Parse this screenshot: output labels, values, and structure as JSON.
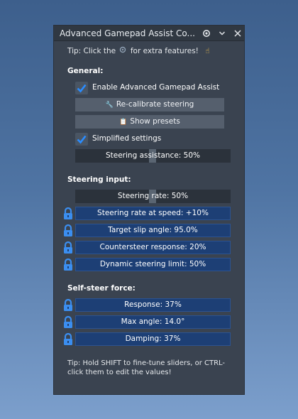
{
  "window": {
    "title": "Advanced Gamepad Assist Co...",
    "icons": [
      "gear-icon",
      "chevron-down-icon",
      "close-icon"
    ]
  },
  "tip_top": {
    "before": "Tip: Click the",
    "after": "for extra features!",
    "icons": [
      "gear-icon",
      "pointing-hand-icon"
    ]
  },
  "general": {
    "heading": "General:",
    "enable_label": "Enable Advanced Gamepad Assist",
    "enable_checked": true,
    "recalibrate_label": "Re-calibrate steering",
    "presets_label": "Show presets",
    "simplified_label": "Simplified settings",
    "simplified_checked": true,
    "steering_assistance": "Steering assistance: 50%",
    "steering_assistance_value": 0.5
  },
  "steering_input": {
    "heading": "Steering input:",
    "steering_rate": "Steering rate: 50%",
    "steering_rate_value": 0.5,
    "locked": [
      "Steering rate at speed: +10%",
      "Target slip angle: 95.0%",
      "Countersteer response: 20%",
      "Dynamic steering limit: 50%"
    ]
  },
  "self_steer": {
    "heading": "Self-steer force:",
    "locked": [
      "Response: 37%",
      "Max angle: 14.0°",
      "Damping: 37%"
    ]
  },
  "tip_bottom": "Tip: Hold SHIFT to fine-tune sliders, or CTRL-click them to edit the values!",
  "colors": {
    "accent_check": "#2a8cff",
    "locked_slider": "#1d3f75",
    "lock_icon": "#3b8ef0"
  }
}
